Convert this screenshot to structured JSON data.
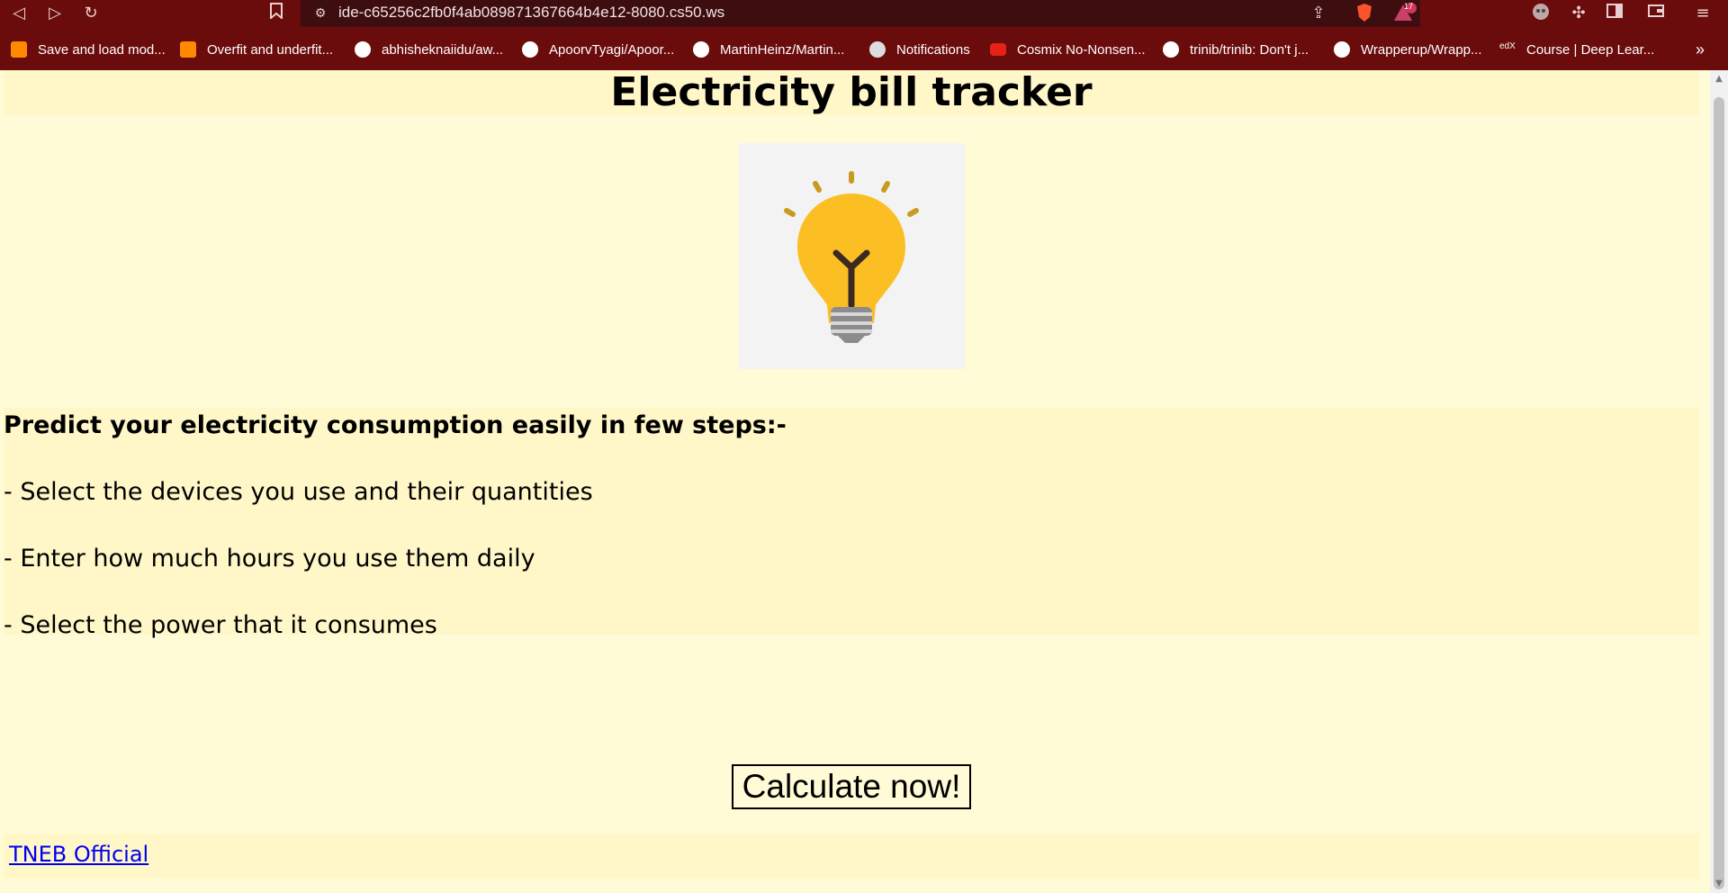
{
  "browser": {
    "url": "ide-c65256c2fb0f4ab089871367664b4e12-8080.cs50.ws",
    "notification_count": "17",
    "bookmarks": [
      {
        "label": "Save and load mod...",
        "icon": "tensorflow-icon"
      },
      {
        "label": "Overfit and underfit...",
        "icon": "tensorflow-icon"
      },
      {
        "label": "abhisheknaiidu/aw...",
        "icon": "github-icon"
      },
      {
        "label": "ApoorvTyagi/Apoor...",
        "icon": "github-icon"
      },
      {
        "label": "MartinHeinz/Martin...",
        "icon": "github-icon"
      },
      {
        "label": "Notifications",
        "icon": "globe-icon"
      },
      {
        "label": "Cosmix No-Nonsen...",
        "icon": "youtube-icon"
      },
      {
        "label": "trinib/trinib: Don't j...",
        "icon": "github-icon"
      },
      {
        "label": "Wrapperup/Wrapp...",
        "icon": "github-icon"
      },
      {
        "label": "Course | Deep Lear...",
        "icon": "edx-icon"
      }
    ],
    "more_bookmarks": "»"
  },
  "page": {
    "title": "Electricity bill tracker",
    "steps_heading": "Predict your electricity consumption easily in few steps:-",
    "steps": [
      "- Select the devices you use and their quantities",
      "- Enter how much hours you use them daily",
      "- Select the power that it consumes"
    ],
    "cta_label": "Calculate now!",
    "footer_link": "TNEB Official"
  },
  "colors": {
    "chrome": "#6b0c0c",
    "page_bg": "#fffbd6",
    "section_bg": "#fff7c8",
    "bulb_yellow": "#fbbf24",
    "link": "#0000ee"
  }
}
